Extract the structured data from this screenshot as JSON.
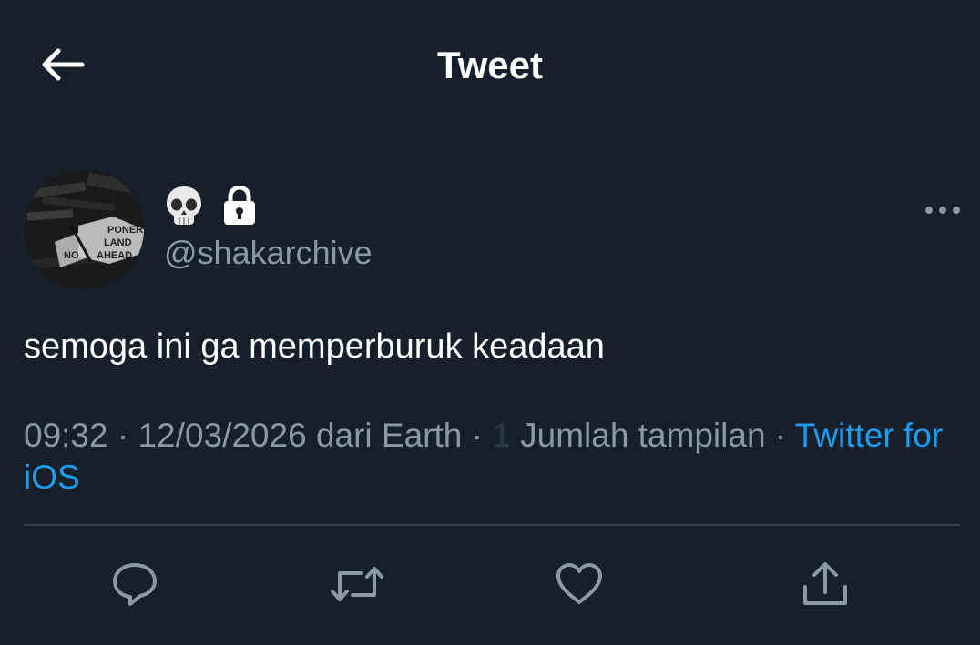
{
  "header": {
    "title": "Tweet",
    "back_icon": "arrow-left-icon"
  },
  "author": {
    "name_emoji": "💀",
    "protected_icon": "lock-icon",
    "handle": "@shakarchive",
    "avatar_text": [
      "PONER",
      "LAND",
      "AHEAD",
      "NO"
    ]
  },
  "tweet": {
    "text": "semoga ini ga memperburuk keadaan",
    "time": "09:32",
    "date": "12/03/2026",
    "location": "dari Earth",
    "separator": "·",
    "views_count": "1",
    "views_label": "Jumlah tampilan",
    "source": "Twitter for iOS"
  },
  "actions": [
    {
      "name": "reply",
      "icon": "reply-icon"
    },
    {
      "name": "retweet",
      "icon": "retweet-icon"
    },
    {
      "name": "like",
      "icon": "heart-icon"
    },
    {
      "name": "share",
      "icon": "share-icon"
    }
  ],
  "colors": {
    "background": "#15202b",
    "text": "#ffffff",
    "muted": "#8b98a5",
    "link": "#1d9bf0",
    "divider": "#38444d"
  }
}
